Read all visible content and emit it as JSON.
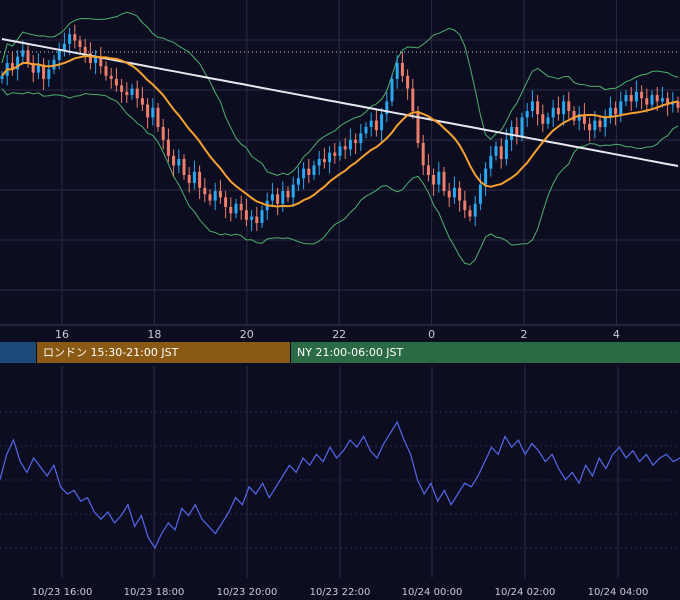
{
  "colors": {
    "background": "#0d0d22",
    "grid": "#2b2b45",
    "up_candle": "#2aa8f0",
    "down_candle": "#ef7f6a",
    "long_ma": "#e8e8f0",
    "short_ma": "#f5a030",
    "bollinger": "#4db06a",
    "oscillator": "#5568e8",
    "dotted_level": "#d0d0d0",
    "session_asia": "#1e4a7a",
    "session_london": "#8a5a14",
    "session_ny": "#2a6a44"
  },
  "main_axis": {
    "tick_labels": [
      "16",
      "18",
      "20",
      "22",
      "0",
      "2",
      "4"
    ]
  },
  "sessions": {
    "asia": {
      "label": ""
    },
    "london": {
      "label": "ロンドン 15:30-21:00 JST"
    },
    "ny": {
      "label": "NY 21:00-06:00 JST"
    }
  },
  "sub_axis": {
    "tick_labels": [
      "10/23 16:00",
      "10/23 18:00",
      "10/23 20:00",
      "10/23 22:00",
      "10/24 00:00",
      "10/24 02:00",
      "10/24 04:00"
    ]
  },
  "chart_data": [
    {
      "type": "candlestick",
      "title": "",
      "x_ticks": [
        "16",
        "18",
        "20",
        "22",
        "0",
        "2",
        "4"
      ],
      "series": [
        {
          "kind": "candles",
          "bars_per_hour": 10,
          "start_hour": 14.7,
          "close": [
            0.62,
            0.7,
            0.66,
            0.74,
            0.78,
            0.7,
            0.64,
            0.69,
            0.6,
            0.66,
            0.72,
            0.78,
            0.82,
            0.88,
            0.84,
            0.8,
            0.76,
            0.7,
            0.74,
            0.68,
            0.62,
            0.6,
            0.56,
            0.52,
            0.5,
            0.54,
            0.48,
            0.44,
            0.36,
            0.42,
            0.3,
            0.22,
            0.12,
            0.06,
            0.1,
            0.0,
            -0.05,
            0.02,
            -0.08,
            -0.12,
            -0.16,
            -0.1,
            -0.14,
            -0.2,
            -0.24,
            -0.18,
            -0.22,
            -0.28,
            -0.26,
            -0.3,
            -0.22,
            -0.16,
            -0.12,
            -0.18,
            -0.1,
            -0.14,
            -0.06,
            -0.02,
            0.04,
            0.0,
            0.06,
            0.1,
            0.08,
            0.14,
            0.12,
            0.18,
            0.16,
            0.22,
            0.2,
            0.26,
            0.3,
            0.34,
            0.28,
            0.38,
            0.46,
            0.6,
            0.7,
            0.62,
            0.54,
            0.4,
            0.2,
            0.06,
            0.0,
            -0.06,
            0.02,
            -0.1,
            -0.14,
            -0.08,
            -0.16,
            -0.22,
            -0.26,
            -0.18,
            -0.06,
            0.04,
            0.12,
            0.18,
            0.1,
            0.22,
            0.3,
            0.24,
            0.36,
            0.4,
            0.46,
            0.38,
            0.32,
            0.36,
            0.42,
            0.38,
            0.46,
            0.4,
            0.34,
            0.38,
            0.32,
            0.28,
            0.34,
            0.3,
            0.36,
            0.42,
            0.38,
            0.46,
            0.5,
            0.46,
            0.52,
            0.48,
            0.44,
            0.5,
            0.46,
            0.48,
            0.44,
            0.46,
            0.42
          ]
        },
        {
          "kind": "line",
          "name": "",
          "role": "long moving average"
        },
        {
          "kind": "line",
          "name": "",
          "role": "short moving average"
        },
        {
          "kind": "band",
          "name": "",
          "role": "bollinger bands"
        }
      ]
    },
    {
      "type": "line",
      "title": "",
      "x_ticks": [
        "10/23 16:00",
        "10/23 18:00",
        "10/23 20:00",
        "10/23 22:00",
        "10/24 00:00",
        "10/24 02:00",
        "10/24 04:00"
      ],
      "series": [
        {
          "name": "",
          "values": [
            0.48,
            0.62,
            0.7,
            0.58,
            0.52,
            0.6,
            0.55,
            0.5,
            0.56,
            0.44,
            0.4,
            0.42,
            0.36,
            0.38,
            0.3,
            0.26,
            0.3,
            0.24,
            0.28,
            0.34,
            0.22,
            0.28,
            0.16,
            0.1,
            0.18,
            0.24,
            0.2,
            0.32,
            0.28,
            0.34,
            0.26,
            0.22,
            0.18,
            0.24,
            0.3,
            0.38,
            0.34,
            0.44,
            0.4,
            0.46,
            0.38,
            0.44,
            0.5,
            0.56,
            0.52,
            0.6,
            0.56,
            0.62,
            0.58,
            0.66,
            0.6,
            0.64,
            0.7,
            0.66,
            0.72,
            0.64,
            0.6,
            0.68,
            0.74,
            0.8,
            0.7,
            0.62,
            0.48,
            0.4,
            0.46,
            0.36,
            0.42,
            0.34,
            0.4,
            0.46,
            0.44,
            0.5,
            0.58,
            0.66,
            0.62,
            0.72,
            0.66,
            0.7,
            0.62,
            0.68,
            0.64,
            0.58,
            0.62,
            0.54,
            0.48,
            0.52,
            0.46,
            0.56,
            0.5,
            0.6,
            0.54,
            0.62,
            0.66,
            0.6,
            0.64,
            0.58,
            0.62,
            0.56,
            0.6,
            0.62,
            0.58,
            0.6
          ]
        }
      ]
    }
  ]
}
